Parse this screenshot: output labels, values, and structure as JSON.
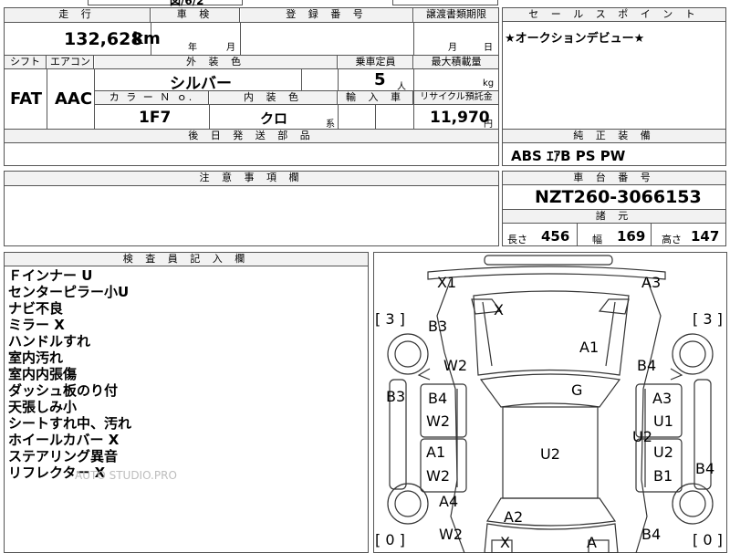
{
  "top_fragment": "図/6/2",
  "labels": {
    "mileage": "走 行",
    "inspection": "車 検",
    "registration": "登 録 番 号",
    "transfer_docs": "譲渡書類期限",
    "sales_point": "セ ー ル ス ポ イ ン ト",
    "shift": "シフト",
    "aircon": "エアコン",
    "exterior_color": "外 装 色",
    "capacity": "乗車定員",
    "max_load": "最大積載量",
    "color_no": "カ ラ ー Ｎ ｏ.",
    "interior_color": "内 装 色",
    "import": "輸 入 車",
    "recycle": "リサイクル預託金",
    "later_parts": "後 日 発 送 部 品",
    "genuine_equipment": "純 正 装 備",
    "notes": "注 意 事 項 欄",
    "chassis_no": "車 台 番 号",
    "specs": "諸 元",
    "inspector_notes": "検 査 員 記 入 欄"
  },
  "values": {
    "mileage_num": "132,628",
    "mileage_unit": "km",
    "inspection_year": "年",
    "inspection_month": "月",
    "transfer_month": "月",
    "transfer_day": "日",
    "sales_point": "★オークションデビュー★",
    "shift": "FAT",
    "aircon": "AAC",
    "exterior_color": "シルバー",
    "capacity": "5",
    "capacity_unit": "人",
    "load_unit": "kg",
    "color_no": "1F7",
    "interior_color": "クロ",
    "interior_suffix": "系",
    "recycle_amount": "11,970",
    "recycle_unit": "円",
    "genuine_equipment": "ABS  ｴｱB  PS  PW",
    "chassis_no": "NZT260-3066153",
    "length_label": "長さ",
    "length": "456",
    "width_label": "幅",
    "width": "169",
    "height_label": "高さ",
    "height": "147"
  },
  "inspector_lines": [
    "Ｆインナー U",
    "センターピラー小U",
    "ナビ不良",
    "ミラー X",
    "ハンドルすれ",
    "室内汚れ",
    "室内内張傷",
    "ダッシュ板のり付",
    "天張しみ小",
    "シートすれ中、汚れ",
    "ホイールカバー X",
    "ステアリング異音",
    "リフレクター X"
  ],
  "watermark": "AUTO STUDIO.PRO",
  "diagram_marks": {
    "x1": "X1",
    "a3_top": "A3",
    "x_wind": "X",
    "tire_left_front": "[ 3 ]",
    "tire_right_front": "[ 3 ]",
    "b3_upper": "B3",
    "a1_hood": "A1",
    "w2_left_front": "W2",
    "b4_right_front": "B4",
    "b3_left": "B3",
    "g_windshield": "G",
    "b4_left_door": "B4",
    "w2_left_door": "W2",
    "a3_right_door": "A3",
    "u1_right_door": "U1",
    "u2_right_mid": "U2",
    "a1_left_rear": "A1",
    "w2_left_rear": "W2",
    "u2_roof": "U2",
    "u2_right_rear": "U2",
    "b1_right_rear": "B1",
    "b4_right_side": "B4",
    "a4_rear_left": "A4",
    "a2_trunk": "A2",
    "w2_rear": "W2",
    "b4_rear_right": "B4",
    "tire_left_rear": "[ 0 ]",
    "tire_right_rear": "[ 0 ]",
    "x_rear": "X",
    "a_rear": "A"
  }
}
